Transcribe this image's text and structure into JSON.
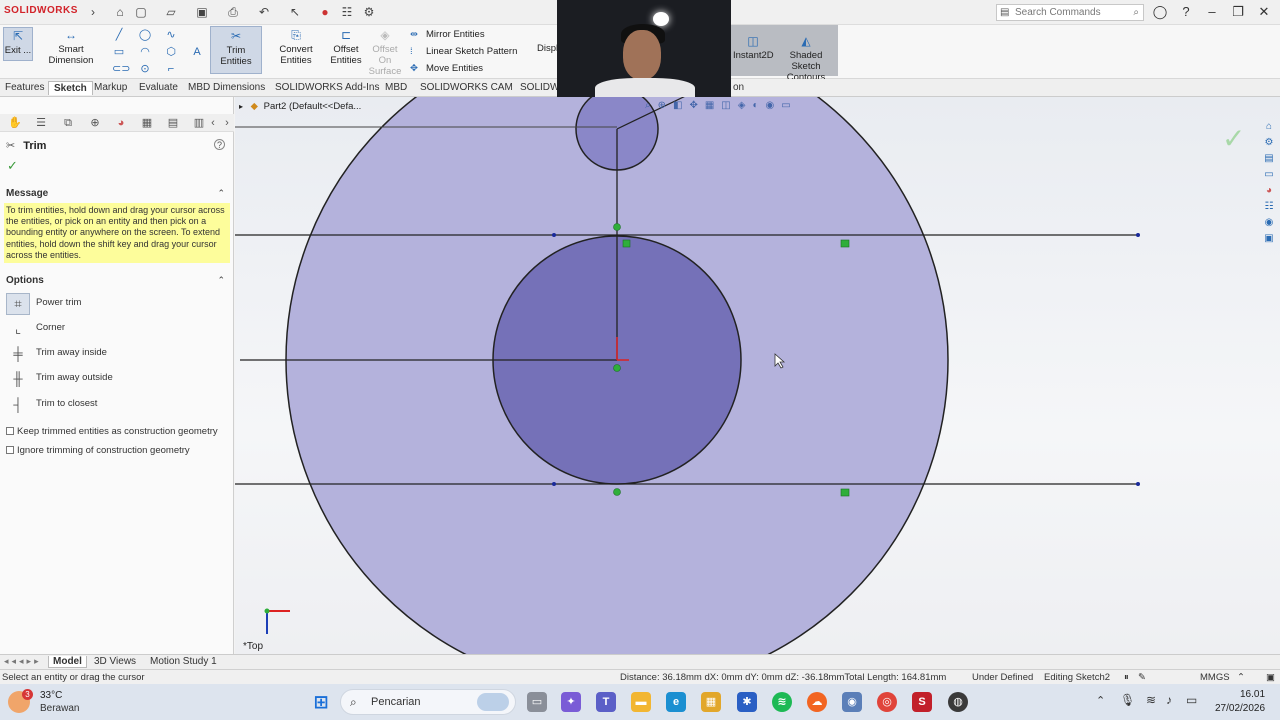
{
  "app": {
    "logo_text": "SOLIDWORKS",
    "search_placeholder": "Search Commands",
    "brand_color": "#d2232a"
  },
  "ribbon": {
    "exit_label": "Exit ...",
    "smart_dimension_label": "Smart Dimension",
    "trim_entities_label": "Trim Entities",
    "convert_entities_label": "Convert Entities",
    "offset_entities_label": "Offset Entities",
    "offset_on_surface_label": "Offset On Surface",
    "mirror_entities_label": "Mirror Entities",
    "linear_pattern_label": "Linear Sketch Pattern",
    "move_entities_label": "Move Entities",
    "display_label": "Displ",
    "instant2d_label": "Instant2D",
    "shaded_contours_label": "Shaded Sketch Contours"
  },
  "tabs": [
    "Features",
    "Sketch",
    "Markup",
    "Evaluate",
    "MBD Dimensions",
    "SOLIDWORKS Add-Ins",
    "MBD",
    "SOLIDWORKS CAM",
    "SOLIDW"
  ],
  "active_tab": "Sketch",
  "tab_tail": "on",
  "tree": {
    "part_label": "Part2  (Default<<Defa..."
  },
  "property_manager": {
    "title": "Trim",
    "message_header": "Message",
    "message_text": "To trim entities, hold down and drag your cursor across the entities, or pick on an entity and then pick on a bounding entity or anywhere on the screen.  To extend entities, hold down the shift key and drag your cursor across the entities.",
    "options_header": "Options",
    "options": [
      {
        "label": "Power trim",
        "selected": true,
        "icon": "power-trim-icon"
      },
      {
        "label": "Corner",
        "selected": false,
        "icon": "corner-trim-icon"
      },
      {
        "label": "Trim away inside",
        "selected": false,
        "icon": "trim-inside-icon"
      },
      {
        "label": "Trim away outside",
        "selected": false,
        "icon": "trim-outside-icon"
      },
      {
        "label": "Trim to closest",
        "selected": false,
        "icon": "trim-closest-icon"
      }
    ],
    "checkbox_keep": "Keep trimmed entities as construction geometry",
    "checkbox_ignore": "Ignore trimming of construction geometry"
  },
  "viewport": {
    "view_label": "*Top",
    "fill_color": "#b4b2dc",
    "inner_fill_color": "#7571b8"
  },
  "bottom_tabs": [
    "Model",
    "3D Views",
    "Motion Study 1"
  ],
  "active_bottom_tab": "Model",
  "status": {
    "hint": "Select an entity or drag the cursor",
    "measure": "Distance: 36.18mm   dX: 0mm   dY: 0mm   dZ: -36.18mmTotal Length: 164.81mm",
    "defined": "Under Defined",
    "editing": "Editing Sketch2",
    "units": "MMGS"
  },
  "taskbar": {
    "temp": "33°C",
    "weather": "Berawan",
    "badge": "3",
    "search_label": "Pencarian",
    "time": "16.01",
    "date": "27/02/2026"
  }
}
